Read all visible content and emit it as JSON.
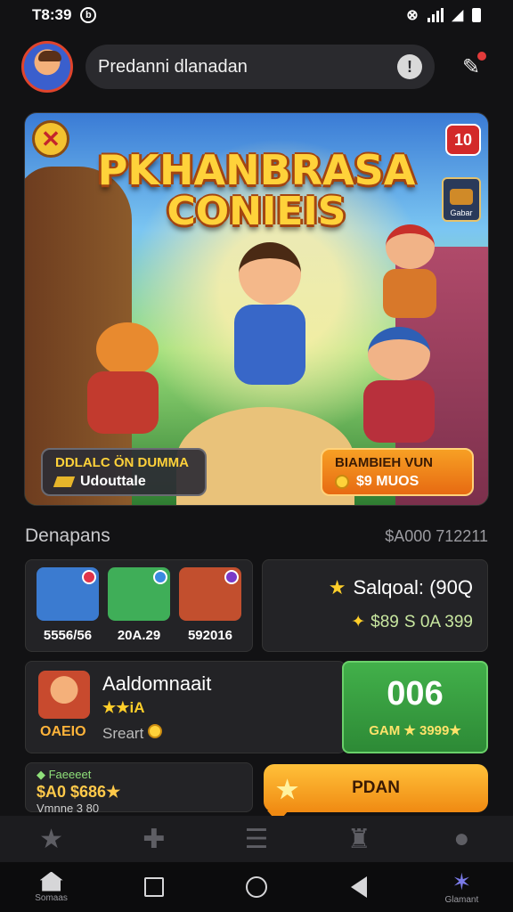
{
  "status_bar": {
    "time": "T8:39",
    "app_icon": "b-icon"
  },
  "header": {
    "search_text": "Predanni dlanadan",
    "info_glyph": "!"
  },
  "hero": {
    "title_line1": "PKHANBRASA",
    "title_line2": "CONIEIS",
    "close_glyph": "✕",
    "badge": "10",
    "chest_label": "Gabar",
    "left_pill": {
      "title": "DDLALC ÖN DUMMA",
      "sub": "Udouttale"
    },
    "right_pill": {
      "title": "BIAMBIEH VUN",
      "sub": "$9 MUOS"
    }
  },
  "section": {
    "title": "Denapans",
    "value": "$A000 712211"
  },
  "games": [
    {
      "value": "5556/56",
      "color": "#3b7bd0",
      "badge_color": "#e0344a"
    },
    {
      "value": "20A.29",
      "color": "#3fae58",
      "badge_color": "#3a8ae0"
    },
    {
      "value": "592016",
      "color": "#c24f2e",
      "badge_color": "#7a3ac8"
    }
  ],
  "balance": {
    "label": "Salqoal: (90Q",
    "sub_a": "$89",
    "sub_b": "S 0A 399"
  },
  "featured": {
    "name": "Aaldomnaait",
    "stars": "★★iA",
    "code": "OAEIO",
    "sub": "Sreart"
  },
  "green_card": {
    "big": "006",
    "small": "GAM ★ 3999★"
  },
  "reward": {
    "label": "Faeeeet",
    "amount": "$A0 $686★",
    "sub": "Vmnne 3 80"
  },
  "cta": {
    "label": "PDAN"
  },
  "nav": {
    "home_label": "Somaas",
    "last_label": "Glamant"
  }
}
